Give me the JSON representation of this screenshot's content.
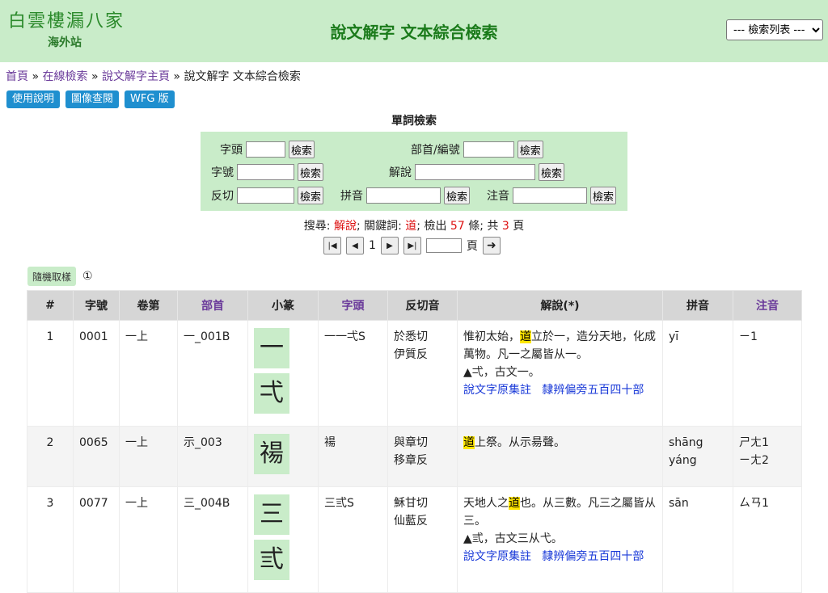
{
  "header": {
    "logo_main": "白雲樓漏八家",
    "logo_sub": "海外站",
    "title": "說文解字 文本綜合檢索",
    "list_select": "--- 檢索列表 ---"
  },
  "breadcrumb": {
    "home": "首頁",
    "sep": "»",
    "online": "在線檢索",
    "main": "說文解字主頁",
    "current": "說文解字 文本綜合檢索"
  },
  "buttons": {
    "manual": "使用說明",
    "image": "圖像查閱",
    "wfg": "WFG 版"
  },
  "search": {
    "title": "單詞檢索",
    "btn": "檢索",
    "zitou": "字頭",
    "bushou": "部首/編號",
    "zihao": "字號",
    "jieshuo": "解說",
    "fanqie": "反切",
    "pinyin": "拼音",
    "zhuyin": "注音"
  },
  "summary": {
    "p1": "搜尋: ",
    "field": "解說",
    "p2": "; 關鍵詞: ",
    "keyword": "道",
    "p3": "; 檢出 ",
    "count": "57",
    "p4": " 條; 共 ",
    "pages": "3",
    "p5": " 頁"
  },
  "pager": {
    "page": "1",
    "page_unit": "頁"
  },
  "random": {
    "label": "隨機取樣",
    "marker": "①"
  },
  "table": {
    "headers": [
      "#",
      "字號",
      "卷第",
      "部首",
      "小篆",
      "字頭",
      "反切音",
      "解說(*)",
      "拼音",
      "注音"
    ],
    "rows": [
      {
        "n": "1",
        "zihao": "0001",
        "juan": "一上",
        "bushou": "一_001B",
        "seal1": "一",
        "seal2": "弌",
        "zitou": "一一弌S",
        "fq1": "於悉切",
        "fq2": "伊質反",
        "js_pre": "惟初太始，",
        "js_hl": "道",
        "js_post": "立於一，造分天地，化成萬物。凡一之屬皆从一。",
        "js_line2": "▲弌，古文一。",
        "link1": "說文字原集註",
        "link2": "隸辨偏旁五百四十部",
        "py1": "yī",
        "py2": "",
        "zy1": "ㄧ1",
        "zy2": ""
      },
      {
        "n": "2",
        "zihao": "0065",
        "juan": "一上",
        "bushou": "示_003",
        "seal1": "禓",
        "zitou": "禓",
        "fq1": "與章切",
        "fq2": "移章反",
        "js_pre": "",
        "js_hl": "道",
        "js_post": "上祭。从示昜聲。",
        "py1": "shāng",
        "py2": "yáng",
        "zy1": "ㄕㄤ1",
        "zy2": "ㄧㄤ2"
      },
      {
        "n": "3",
        "zihao": "0077",
        "juan": "一上",
        "bushou": "三_004B",
        "seal1": "三",
        "seal2": "弎",
        "zitou": "三弎S",
        "fq1": "穌甘切",
        "fq2": "仙藍反",
        "js_pre": "天地人之",
        "js_hl": "道",
        "js_post": "也。从三數。凡三之屬皆从三。",
        "js_line2": "▲弎，古文三从弋。",
        "link1": "說文字原集註",
        "link2": "隸辨偏旁五百四十部",
        "py1": "sān",
        "py2": "",
        "zy1": "ㄙㄢ1",
        "zy2": ""
      }
    ]
  }
}
